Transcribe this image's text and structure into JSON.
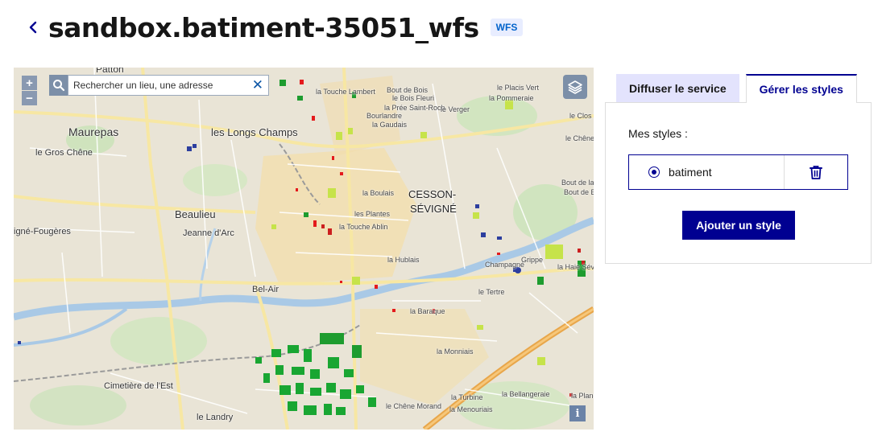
{
  "header": {
    "back_icon": "chevron-left-icon",
    "title": "sandbox.batiment-35051_wfs",
    "badge": "WFS"
  },
  "map": {
    "zoom_in": "+",
    "zoom_out": "−",
    "search_placeholder": "Rechercher un lieu, une adresse",
    "clear_icon": "✕",
    "info_label": "i",
    "places": {
      "patton": "Patton",
      "maurepas": "Maurepas",
      "gros_chene": "le Gros Chêne",
      "longs_champs": "les Longs Champs",
      "beaulieu": "Beaulieu",
      "jeanne_darc": "Jeanne d'Arc",
      "fougeres": "igné-Fougères",
      "cesson": "CESSON-",
      "sevigne": "SÉVIGNÉ",
      "bel_air": "Bel-Air",
      "cimetiere": "Cimetière de l'Est",
      "landry": "le Landry",
      "touche_lambert": "la Touche Lambert",
      "bout_de_bois": "Bout de Bois",
      "bois_fleuri": "le Bois Fleuri",
      "placis_vert": "le Placis Vert",
      "pommeraie": "la Pommeraie",
      "pree_saint_roch": "la Prée Saint-Roch",
      "le_verger": "le Verger",
      "bourlandre": "Bourlandre",
      "gaudais": "la Gaudais",
      "le_clos": "le Clos",
      "boulais": "la Boulais",
      "les_plantes": "les Plantes",
      "touche_ablin": "la Touche Ablin",
      "hublais": "la Hublais",
      "champagne": "Champagné",
      "grippe": "Grippe",
      "haie_sevigne": "la Haie Sévig",
      "tertre": "le Tertre",
      "baraque": "la Baraque",
      "monniais": "la Monniais",
      "turbine": "la Turbine",
      "bellangeraie": "la Bellangeraie",
      "planch": "la Planch",
      "chene_morand": "le Chêne Morand",
      "menouriais": "la Menouriais",
      "chene_vert": "le Chêne V",
      "bout_de_la_lande": "Bout de la Lande",
      "bout_de_bas": "Bout de Bas"
    }
  },
  "tabs": [
    {
      "label": "Diffuser le service",
      "active": false
    },
    {
      "label": "Gérer les styles",
      "active": true
    }
  ],
  "styles_panel": {
    "label": "Mes styles :",
    "styles": [
      {
        "name": "batiment",
        "selected": true
      }
    ],
    "delete_icon": "trash-icon",
    "add_button": "Ajouter un style"
  },
  "colors": {
    "primary": "#000091",
    "badge_bg": "#e8edff",
    "badge_text": "#0063cb",
    "tab_inactive_bg": "#e3e3fd"
  }
}
